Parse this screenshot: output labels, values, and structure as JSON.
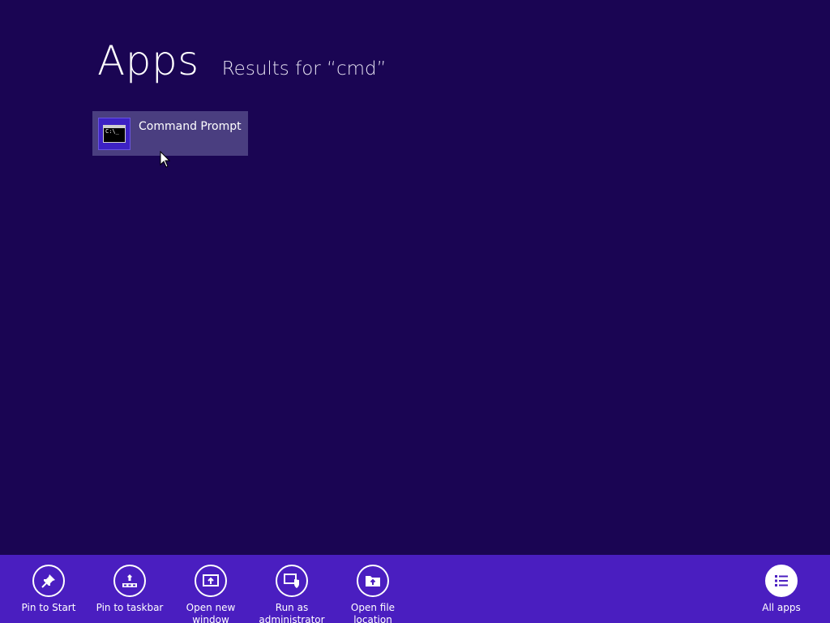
{
  "header": {
    "title": "Apps",
    "subtitle": "Results for “cmd”"
  },
  "results": [
    {
      "label": "Command Prompt",
      "icon": "command-prompt-icon",
      "icon_text": "C:\\_"
    }
  ],
  "app_bar": {
    "commands": [
      {
        "label": "Pin to Start",
        "icon": "pin-icon"
      },
      {
        "label": "Pin to taskbar",
        "icon": "pin-taskbar-icon"
      },
      {
        "label": "Open new window",
        "icon": "new-window-icon"
      },
      {
        "label": "Run as administrator",
        "icon": "shield-icon"
      },
      {
        "label": "Open file location",
        "icon": "folder-icon"
      }
    ],
    "all_apps": {
      "label": "All apps",
      "icon": "list-icon"
    }
  },
  "colors": {
    "background": "#1a0553",
    "app_bar": "#4a1ec0",
    "tile_selected": "#4a3e80",
    "tile_icon_bg": "#3d22c4"
  }
}
